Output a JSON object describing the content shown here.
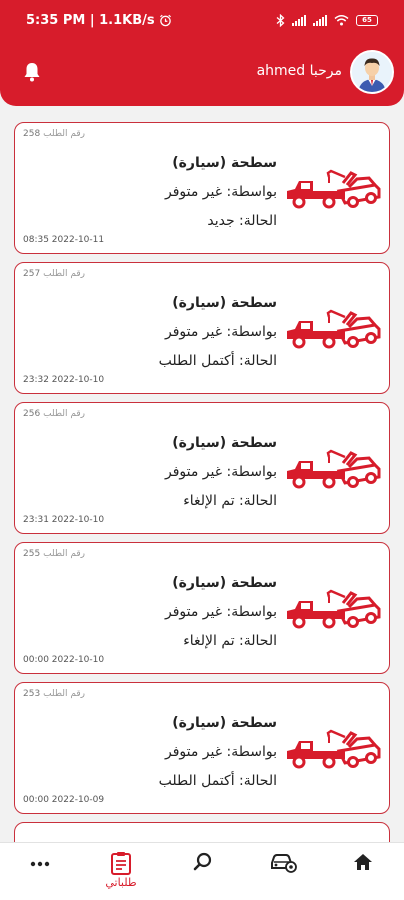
{
  "status_bar": {
    "time": "5:35 PM | 1.1KB/s",
    "battery": "65"
  },
  "header": {
    "greeting_prefix": "مرحبا",
    "user_name": "ahmed",
    "brand_color": "#d71c2b",
    "bell_icon": "bell-icon",
    "avatar_icon": "user-avatar"
  },
  "orders": [
    {
      "number": "258",
      "number_label": "رقم الطلب",
      "title": "سطحة (سيارة)",
      "by_label": "بواسطة:",
      "by_value": "غير متوفر",
      "status_label": "الحالة:",
      "status_value": "جديد",
      "date": "08:35 2022-10-11"
    },
    {
      "number": "257",
      "number_label": "رقم الطلب",
      "title": "سطحة (سيارة)",
      "by_label": "بواسطة:",
      "by_value": "غير متوفر",
      "status_label": "الحالة:",
      "status_value": "أكتمل الطلب",
      "date": "23:32 2022-10-10"
    },
    {
      "number": "256",
      "number_label": "رقم الطلب",
      "title": "سطحة (سيارة)",
      "by_label": "بواسطة:",
      "by_value": "غير متوفر",
      "status_label": "الحالة:",
      "status_value": "تم الإلغاء",
      "date": "23:31 2022-10-10"
    },
    {
      "number": "255",
      "number_label": "رقم الطلب",
      "title": "سطحة (سيارة)",
      "by_label": "بواسطة:",
      "by_value": "غير متوفر",
      "status_label": "الحالة:",
      "status_value": "تم الإلغاء",
      "date": "00:00 2022-10-10"
    },
    {
      "number": "253",
      "number_label": "رقم الطلب",
      "title": "سطحة (سيارة)",
      "by_label": "بواسطة:",
      "by_value": "غير متوفر",
      "status_label": "الحالة:",
      "status_value": "أكتمل الطلب",
      "date": "00:00 2022-10-09"
    }
  ],
  "bottom_nav": {
    "items": [
      {
        "icon": "more-dots-icon",
        "label": ""
      },
      {
        "icon": "clipboard-icon",
        "label": "طلباتي",
        "active": true
      },
      {
        "icon": "search-icon",
        "label": ""
      },
      {
        "icon": "car-settings-icon",
        "label": ""
      },
      {
        "icon": "home-icon",
        "label": ""
      }
    ]
  }
}
